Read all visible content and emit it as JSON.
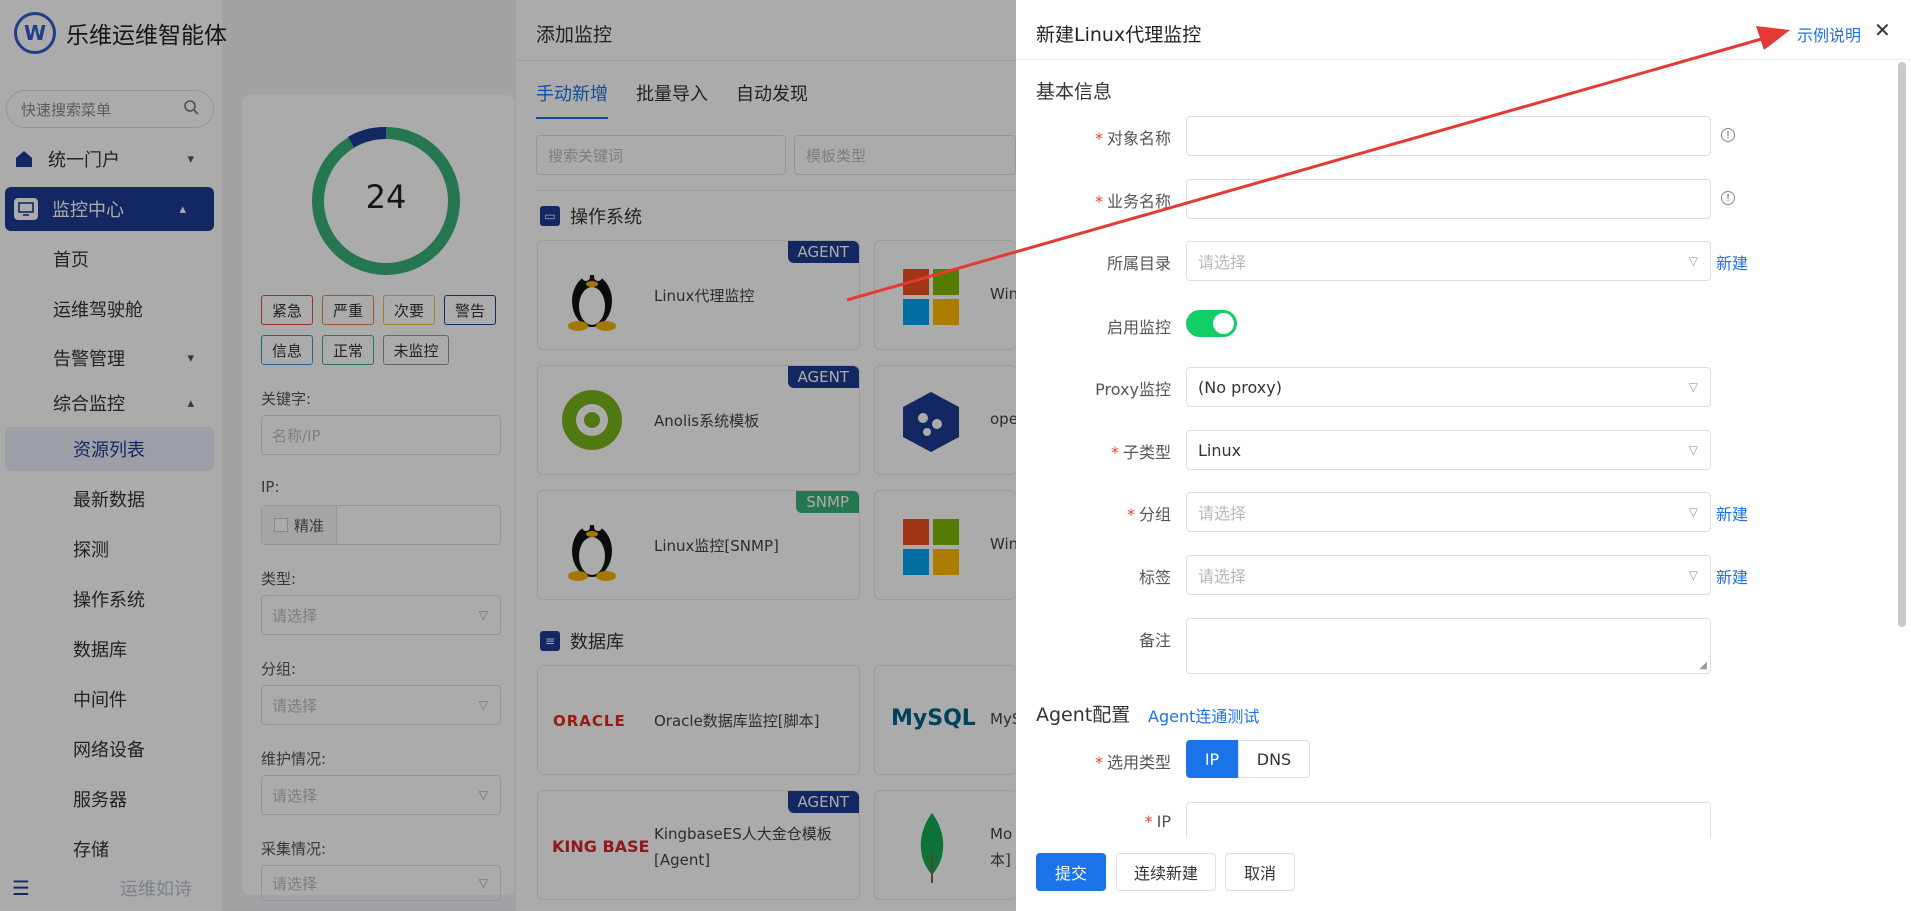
{
  "app": {
    "title": "乐维运维智能体",
    "logo_text": "W"
  },
  "sidebar": {
    "search_placeholder": "快速搜索菜单",
    "items": [
      {
        "label": "统一门户"
      },
      {
        "label": "监控中心"
      },
      {
        "label": "首页"
      },
      {
        "label": "运维驾驶舱"
      },
      {
        "label": "告警管理"
      },
      {
        "label": "综合监控"
      },
      {
        "label": "资源列表"
      },
      {
        "label": "最新数据"
      },
      {
        "label": "探测"
      },
      {
        "label": "操作系统"
      },
      {
        "label": "数据库"
      },
      {
        "label": "中间件"
      },
      {
        "label": "网络设备"
      },
      {
        "label": "服务器"
      },
      {
        "label": "存储"
      }
    ],
    "footer_text": "运维如诗"
  },
  "filter": {
    "donut_value": "24",
    "tags": [
      "紧急",
      "严重",
      "次要",
      "警告",
      "信息",
      "正常",
      "未监控"
    ],
    "keyword_label": "关键字:",
    "keyword_placeholder": "名称/IP",
    "ip_label": "IP:",
    "ip_exact": "精准",
    "type_label": "类型:",
    "type_placeholder": "请选择",
    "group_label": "分组:",
    "group_placeholder": "请选择",
    "maint_label": "维护情况:",
    "maint_placeholder": "请选择",
    "collect_label": "采集情况:",
    "collect_placeholder": "请选择"
  },
  "add_panel": {
    "title": "添加监控",
    "tabs": [
      "手动新增",
      "批量导入",
      "自动发现"
    ],
    "search_placeholder": "搜索关键词",
    "template_type_placeholder": "模板类型",
    "cat_os": "操作系统",
    "cat_db": "数据库",
    "cards": [
      {
        "label": "Linux代理监控",
        "badge": "AGENT"
      },
      {
        "label": "Anolis系统模板",
        "badge": "AGENT"
      },
      {
        "label": "Linux监控[SNMP]",
        "badge": "SNMP"
      },
      {
        "label": "Oracle数据库监控[脚本]",
        "badge": ""
      },
      {
        "label": "KingbaseES人大金仓模板[Agent]",
        "badge": "AGENT"
      }
    ],
    "cards_right": [
      "Win",
      "ope",
      "Win",
      "MyS",
      "Mo"
    ],
    "cards_right_extra": "本]",
    "oracle_logo": "ORACLE",
    "mysql_logo": "MySQL",
    "kingbase_logo": "KING BASE"
  },
  "drawer": {
    "title": "新建Linux代理监控",
    "example_link": "示例说明",
    "basic_section": "基本信息",
    "fields": {
      "object_name": "对象名称",
      "business_name": "业务名称",
      "directory": "所属目录",
      "enable": "启用监控",
      "proxy": "Proxy监控",
      "subtype": "子类型",
      "group": "分组",
      "tags": "标签",
      "note": "备注",
      "select_type": "选用类型",
      "ip": "IP"
    },
    "placeholder_select": "请选择",
    "proxy_value": "(No proxy)",
    "subtype_value": "Linux",
    "new_link": "新建",
    "agent_section": "Agent配置",
    "agent_test_link": "Agent连通测试",
    "seg_ip": "IP",
    "seg_dns": "DNS",
    "buttons": {
      "submit": "提交",
      "continue": "连续新建",
      "cancel": "取消"
    },
    "enable_on": true
  },
  "colors": {
    "brand": "#1d3b93",
    "link": "#1a73e8",
    "success": "#13ce66",
    "required": "#f04134",
    "annotation_arrow": "#e53935"
  }
}
